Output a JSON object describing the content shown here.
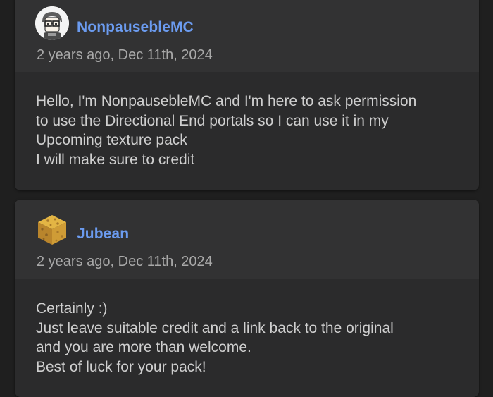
{
  "comments": [
    {
      "avatar_icon": "character-avatar-icon",
      "username": "NonpausebleMC",
      "timestamp": "2 years ago, Dec 11th, 2024",
      "body_lines": [
        "Hello, I'm NonpausebleMC and I'm here to ask permission",
        "to use the Directional End portals so I can use it in my",
        "Upcoming texture pack",
        "I will make sure to credit"
      ]
    },
    {
      "avatar_icon": "sponge-block-avatar-icon",
      "username": "Jubean",
      "timestamp": "2 years ago, Dec 11th, 2024",
      "body_lines": [
        "Certainly :)",
        "Just leave suitable credit and a link back to the original",
        "and you are more than welcome.",
        "Best of luck for your pack!"
      ]
    }
  ],
  "colors": {
    "page_bg": "#1f1f1f",
    "card_bg": "#2b2b2c",
    "header_bg": "#323233",
    "username": "#6b9bef",
    "timestamp": "#a9a9a9",
    "body_text": "#cfcfcf"
  }
}
